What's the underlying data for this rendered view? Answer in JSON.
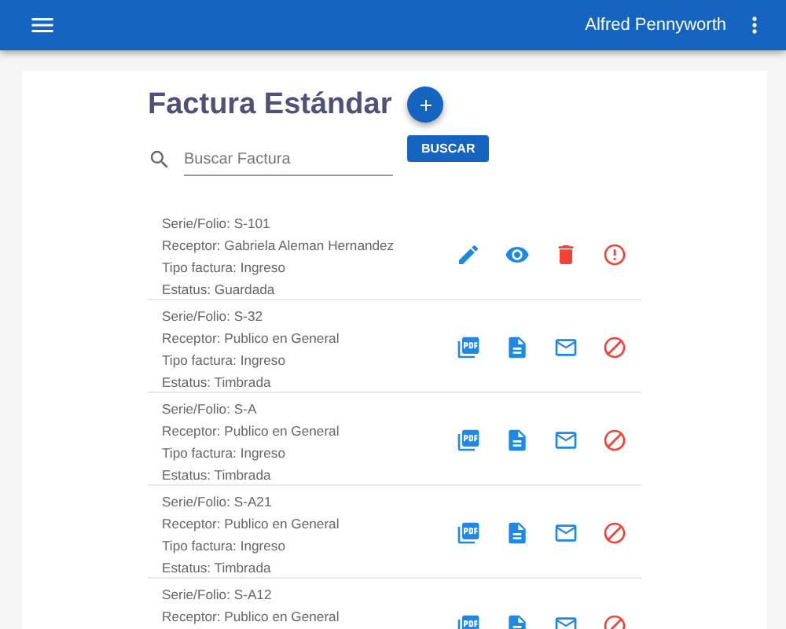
{
  "app_bar": {
    "user": "Alfred Pennyworth"
  },
  "page": {
    "title": "Factura Estándar"
  },
  "search": {
    "placeholder": "Buscar Factura",
    "button": "BUSCAR"
  },
  "invoices": [
    {
      "lines": [
        "Serie/Folio: S-101",
        "Receptor: Gabriela Aleman Hernandez",
        "Tipo factura: Ingreso",
        "Estatus: Guardada"
      ],
      "actions": [
        {
          "kind": "edit"
        },
        {
          "kind": "view"
        },
        {
          "kind": "delete"
        },
        {
          "kind": "alert"
        }
      ]
    },
    {
      "lines": [
        "Serie/Folio: S-32",
        "Receptor: Publico en General",
        "Tipo factura: Ingreso",
        "Estatus: Timbrada"
      ],
      "actions": [
        {
          "kind": "pdf"
        },
        {
          "kind": "xml"
        },
        {
          "kind": "mail"
        },
        {
          "kind": "cancel"
        }
      ]
    },
    {
      "lines": [
        "Serie/Folio: S-A",
        "Receptor: Publico en General",
        "Tipo factura: Ingreso",
        "Estatus: Timbrada"
      ],
      "actions": [
        {
          "kind": "pdf"
        },
        {
          "kind": "xml"
        },
        {
          "kind": "mail"
        },
        {
          "kind": "cancel"
        }
      ]
    },
    {
      "lines": [
        "Serie/Folio: S-A21",
        "Receptor: Publico en General",
        "Tipo factura: Ingreso",
        "Estatus: Timbrada"
      ],
      "actions": [
        {
          "kind": "pdf"
        },
        {
          "kind": "xml"
        },
        {
          "kind": "mail"
        },
        {
          "kind": "cancel"
        }
      ]
    },
    {
      "lines": [
        "Serie/Folio: S-A12",
        "Receptor: Publico en General"
      ],
      "actions": [
        {
          "kind": "pdf"
        },
        {
          "kind": "xml"
        },
        {
          "kind": "mail"
        },
        {
          "kind": "cancel"
        }
      ]
    }
  ]
}
